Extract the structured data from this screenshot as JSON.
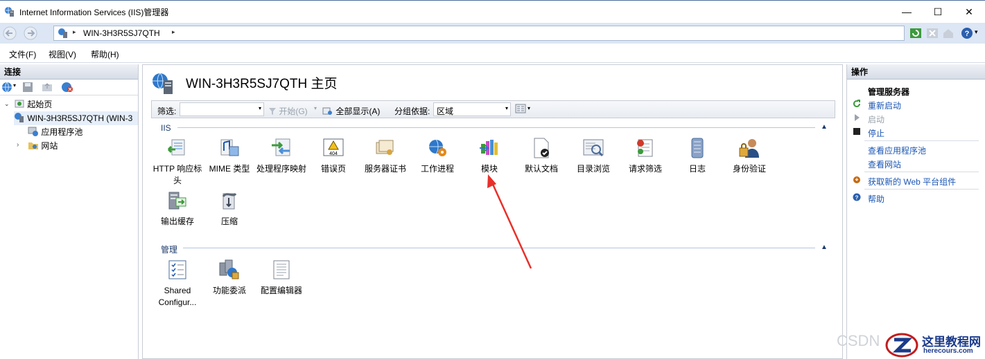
{
  "window": {
    "title": "Internet Information Services (IIS)管理器",
    "controls": {
      "minimize": "—",
      "maximize": "☐",
      "close": "✕"
    }
  },
  "address": {
    "crumb": "WIN-3H3R5SJ7QTH",
    "separator": "▸"
  },
  "menu": [
    "文件(F)",
    "视图(V)",
    "帮助(H)"
  ],
  "left": {
    "header": "连接",
    "tree": {
      "start": "起始页",
      "server": "WIN-3H3R5SJ7QTH (WIN-3",
      "app_pools": "应用程序池",
      "sites": "网站"
    }
  },
  "center": {
    "title": "WIN-3H3R5SJ7QTH 主页",
    "filter": {
      "label": "筛选:",
      "start": "开始(G)",
      "show_all": "全部显示(A)",
      "group_by_label": "分组依据:",
      "group_by_value": "区域"
    },
    "sections": [
      {
        "name": "IIS",
        "items": [
          {
            "label": "HTTP 响应标头",
            "icon": "http-response-headers-icon"
          },
          {
            "label": "MIME 类型",
            "icon": "mime-types-icon"
          },
          {
            "label": "处理程序映射",
            "icon": "handler-mappings-icon"
          },
          {
            "label": "错误页",
            "icon": "error-pages-icon"
          },
          {
            "label": "服务器证书",
            "icon": "server-certificates-icon"
          },
          {
            "label": "工作进程",
            "icon": "worker-processes-icon"
          },
          {
            "label": "模块",
            "icon": "modules-icon"
          },
          {
            "label": "默认文档",
            "icon": "default-document-icon"
          },
          {
            "label": "目录浏览",
            "icon": "directory-browsing-icon"
          },
          {
            "label": "请求筛选",
            "icon": "request-filtering-icon"
          },
          {
            "label": "日志",
            "icon": "logging-icon"
          },
          {
            "label": "身份验证",
            "icon": "authentication-icon"
          },
          {
            "label": "输出缓存",
            "icon": "output-caching-icon"
          },
          {
            "label": "压缩",
            "icon": "compression-icon"
          }
        ]
      },
      {
        "name": "管理",
        "items": [
          {
            "label": "Shared Configur...",
            "icon": "shared-configuration-icon"
          },
          {
            "label": "功能委派",
            "icon": "feature-delegation-icon"
          },
          {
            "label": "配置编辑器",
            "icon": "configuration-editor-icon"
          }
        ]
      }
    ]
  },
  "right": {
    "header": "操作",
    "group_title": "管理服务器",
    "actions": {
      "restart": "重新启动",
      "start": "启动",
      "stop": "停止",
      "view_app_pools": "查看应用程序池",
      "view_sites": "查看网站",
      "get_web_platform": "获取新的 Web 平台组件",
      "help": "帮助"
    }
  },
  "watermark": {
    "csdn": "CSDN",
    "site_name": "这里教程网",
    "site_url": "herecours.com"
  },
  "colors": {
    "accent": "#1a56b4",
    "annotation_arrow": "#e8302a"
  }
}
